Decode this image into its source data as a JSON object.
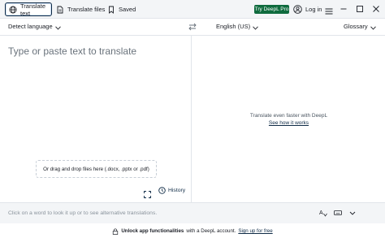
{
  "topbar": {
    "tabs": [
      {
        "label": "Translate text",
        "icon": "globe-icon",
        "active": true
      },
      {
        "label": "Translate files",
        "icon": "file-icon",
        "active": false
      },
      {
        "label": "Saved",
        "icon": "bookmark-icon",
        "active": false
      }
    ],
    "pro_button": "Try DeepL Pro",
    "login": "Log in",
    "accent": "#0f6b3e"
  },
  "langbar": {
    "source": "Detect language",
    "target": "English (US)",
    "glossary": "Glossary"
  },
  "source_panel": {
    "placeholder": "Type or paste text to translate",
    "drop_text": "Or drag and drop files here (.docx, .pptx or .pdf)",
    "history": "History"
  },
  "target_panel": {
    "promo_line": "Translate even faster with DeepL",
    "promo_link": "See how it works"
  },
  "dictionary": {
    "hint": "Click on a word to look it up or to see alternative translations."
  },
  "footer": {
    "bold": "Unlock app functionalities",
    "text": "with a DeepL account.",
    "link": "Sign up for free"
  }
}
